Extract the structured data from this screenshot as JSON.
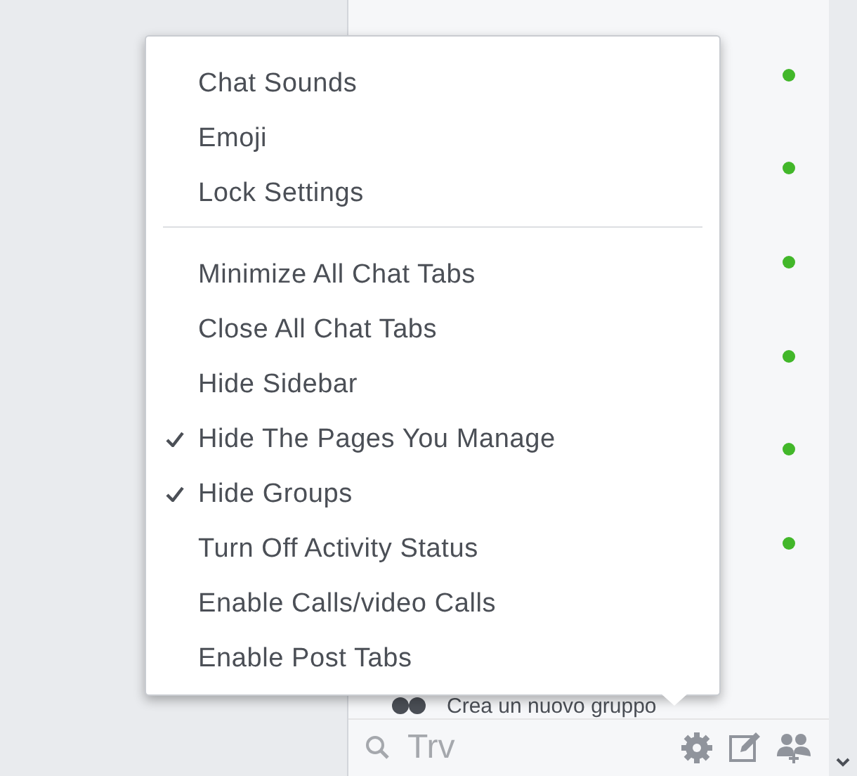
{
  "menu": {
    "items": [
      {
        "label": "Chat Sounds",
        "checked": false
      },
      {
        "label": "Emoji",
        "checked": false
      },
      {
        "label": "Lock Settings",
        "checked": false
      },
      {
        "kind": "divider"
      },
      {
        "label": "Minimize All Chat Tabs",
        "checked": false
      },
      {
        "label": "Close All Chat Tabs",
        "checked": false
      },
      {
        "label": "Hide Sidebar",
        "checked": false
      },
      {
        "label": "Hide The Pages You Manage",
        "checked": true
      },
      {
        "label": "Hide Groups",
        "checked": true
      },
      {
        "label": "Turn Off Activity Status",
        "checked": false
      },
      {
        "label": "Enable Calls/video Calls",
        "checked": false
      },
      {
        "label": "Enable Post Tabs",
        "checked": false
      }
    ]
  },
  "contacts": [
    {
      "online": true
    },
    {
      "online": true
    },
    {
      "online": true
    },
    {
      "online": true
    },
    {
      "online": true
    },
    {
      "online": true
    }
  ],
  "create_group": {
    "label": "Crea un nuovo gruppo"
  },
  "search": {
    "placeholder": "Trv"
  }
}
